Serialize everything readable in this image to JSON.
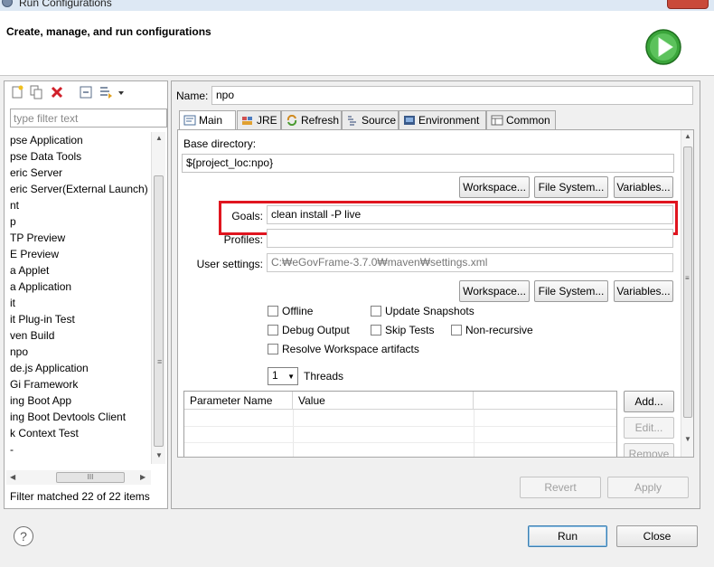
{
  "window": {
    "title": "Run Configurations"
  },
  "header": {
    "title": "Create, manage, and run configurations"
  },
  "left": {
    "filter_placeholder": "type filter text",
    "tree": [
      "pse Application",
      "pse Data Tools",
      "eric Server",
      "eric Server(External Launch)",
      "nt",
      "p",
      "TP Preview",
      "E Preview",
      "a Applet",
      "a Application",
      "it",
      "it Plug-in Test",
      "ven Build",
      "npo",
      "de.js Application",
      "Gi Framework",
      "ing Boot App",
      "ing Boot Devtools Client",
      "k Context Test",
      "-"
    ],
    "selected_index": 13,
    "filter_status": "Filter matched 22 of 22 items"
  },
  "config": {
    "name_label": "Name:",
    "name_value": "npo",
    "tabs": [
      "Main",
      "JRE",
      "Refresh",
      "Source",
      "Environment",
      "Common"
    ],
    "active_tab": "Main",
    "base_dir_label": "Base directory:",
    "base_dir_value": "${project_loc:npo}",
    "workspace_btn": "Workspace...",
    "filesystem_btn": "File System...",
    "variables_btn": "Variables...",
    "goals_label": "Goals:",
    "goals_value": "clean install -P live",
    "profiles_label": "Profiles:",
    "profiles_value": "",
    "user_settings_label": "User settings:",
    "user_settings_value": "C:₩eGovFrame-3.7.0₩maven₩settings.xml",
    "checkboxes": {
      "offline": "Offline",
      "update_snapshots": "Update Snapshots",
      "debug_output": "Debug Output",
      "skip_tests": "Skip Tests",
      "non_recursive": "Non-recursive",
      "resolve_workspace": "Resolve Workspace artifacts"
    },
    "threads_value": "1",
    "threads_label": "Threads",
    "param_headers": [
      "Parameter Name",
      "Value"
    ],
    "add_btn": "Add...",
    "edit_btn": "Edit...",
    "remove_btn": "Remove",
    "revert_btn": "Revert",
    "apply_btn": "Apply"
  },
  "footer": {
    "help": "?",
    "run_btn": "Run",
    "close_btn": "Close"
  },
  "colors": {
    "highlight": "#e0151f",
    "run_green": "#3aa53a",
    "accent": "#3c7fb1"
  }
}
